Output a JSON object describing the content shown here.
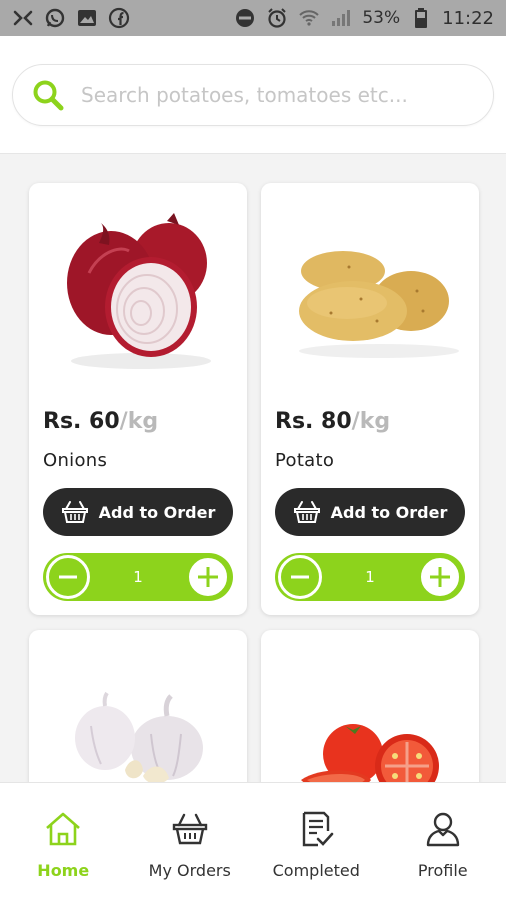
{
  "status_bar": {
    "icons_left": [
      "tools-icon",
      "whatsapp-icon",
      "image-icon",
      "facebook-icon"
    ],
    "icons_right": [
      "dnd-icon",
      "alarm-icon",
      "wifi-icon",
      "signal-icon"
    ],
    "battery": "53%",
    "time": "11:22"
  },
  "search": {
    "placeholder": "Search potatoes, tomatoes etc...",
    "value": ""
  },
  "products": [
    {
      "name": "Onions",
      "price": "Rs. 60",
      "unit": "/kg",
      "add_label": "Add to Order",
      "quantity": "1"
    },
    {
      "name": "Potato",
      "price": "Rs. 80",
      "unit": "/kg",
      "add_label": "Add to Order",
      "quantity": "1"
    },
    {
      "name": "",
      "price": "",
      "unit": "",
      "add_label": "",
      "quantity": ""
    },
    {
      "name": "",
      "price": "",
      "unit": "",
      "add_label": "",
      "quantity": ""
    }
  ],
  "nav": {
    "items": [
      {
        "label": "Home",
        "icon": "home-icon",
        "active": true
      },
      {
        "label": "My Orders",
        "icon": "basket-icon",
        "active": false
      },
      {
        "label": "Completed",
        "icon": "checklist-icon",
        "active": false
      },
      {
        "label": "Profile",
        "icon": "user-icon",
        "active": false
      }
    ]
  },
  "colors": {
    "accent": "#8dd31c",
    "dark_button": "#2a2a2a",
    "status_bar": "#a9a9a9"
  }
}
